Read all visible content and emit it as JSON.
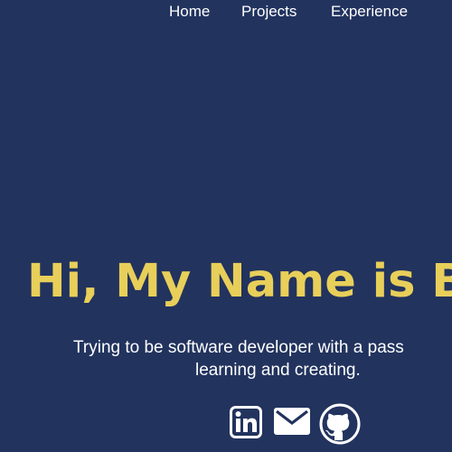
{
  "nav": {
    "items": [
      {
        "label": "Home"
      },
      {
        "label": "Projects"
      },
      {
        "label": "Experience"
      }
    ]
  },
  "hero": {
    "title": "Hi, My Name is B",
    "subtitle_line1": "Trying to be software developer with a pass",
    "subtitle_line2": "learning and creating."
  },
  "socials": {
    "icons": [
      "linkedin-icon",
      "email-icon",
      "github-icon"
    ]
  },
  "colors": {
    "background": "#22335e",
    "accent": "#e8cf5a",
    "text": "#ffffff"
  }
}
